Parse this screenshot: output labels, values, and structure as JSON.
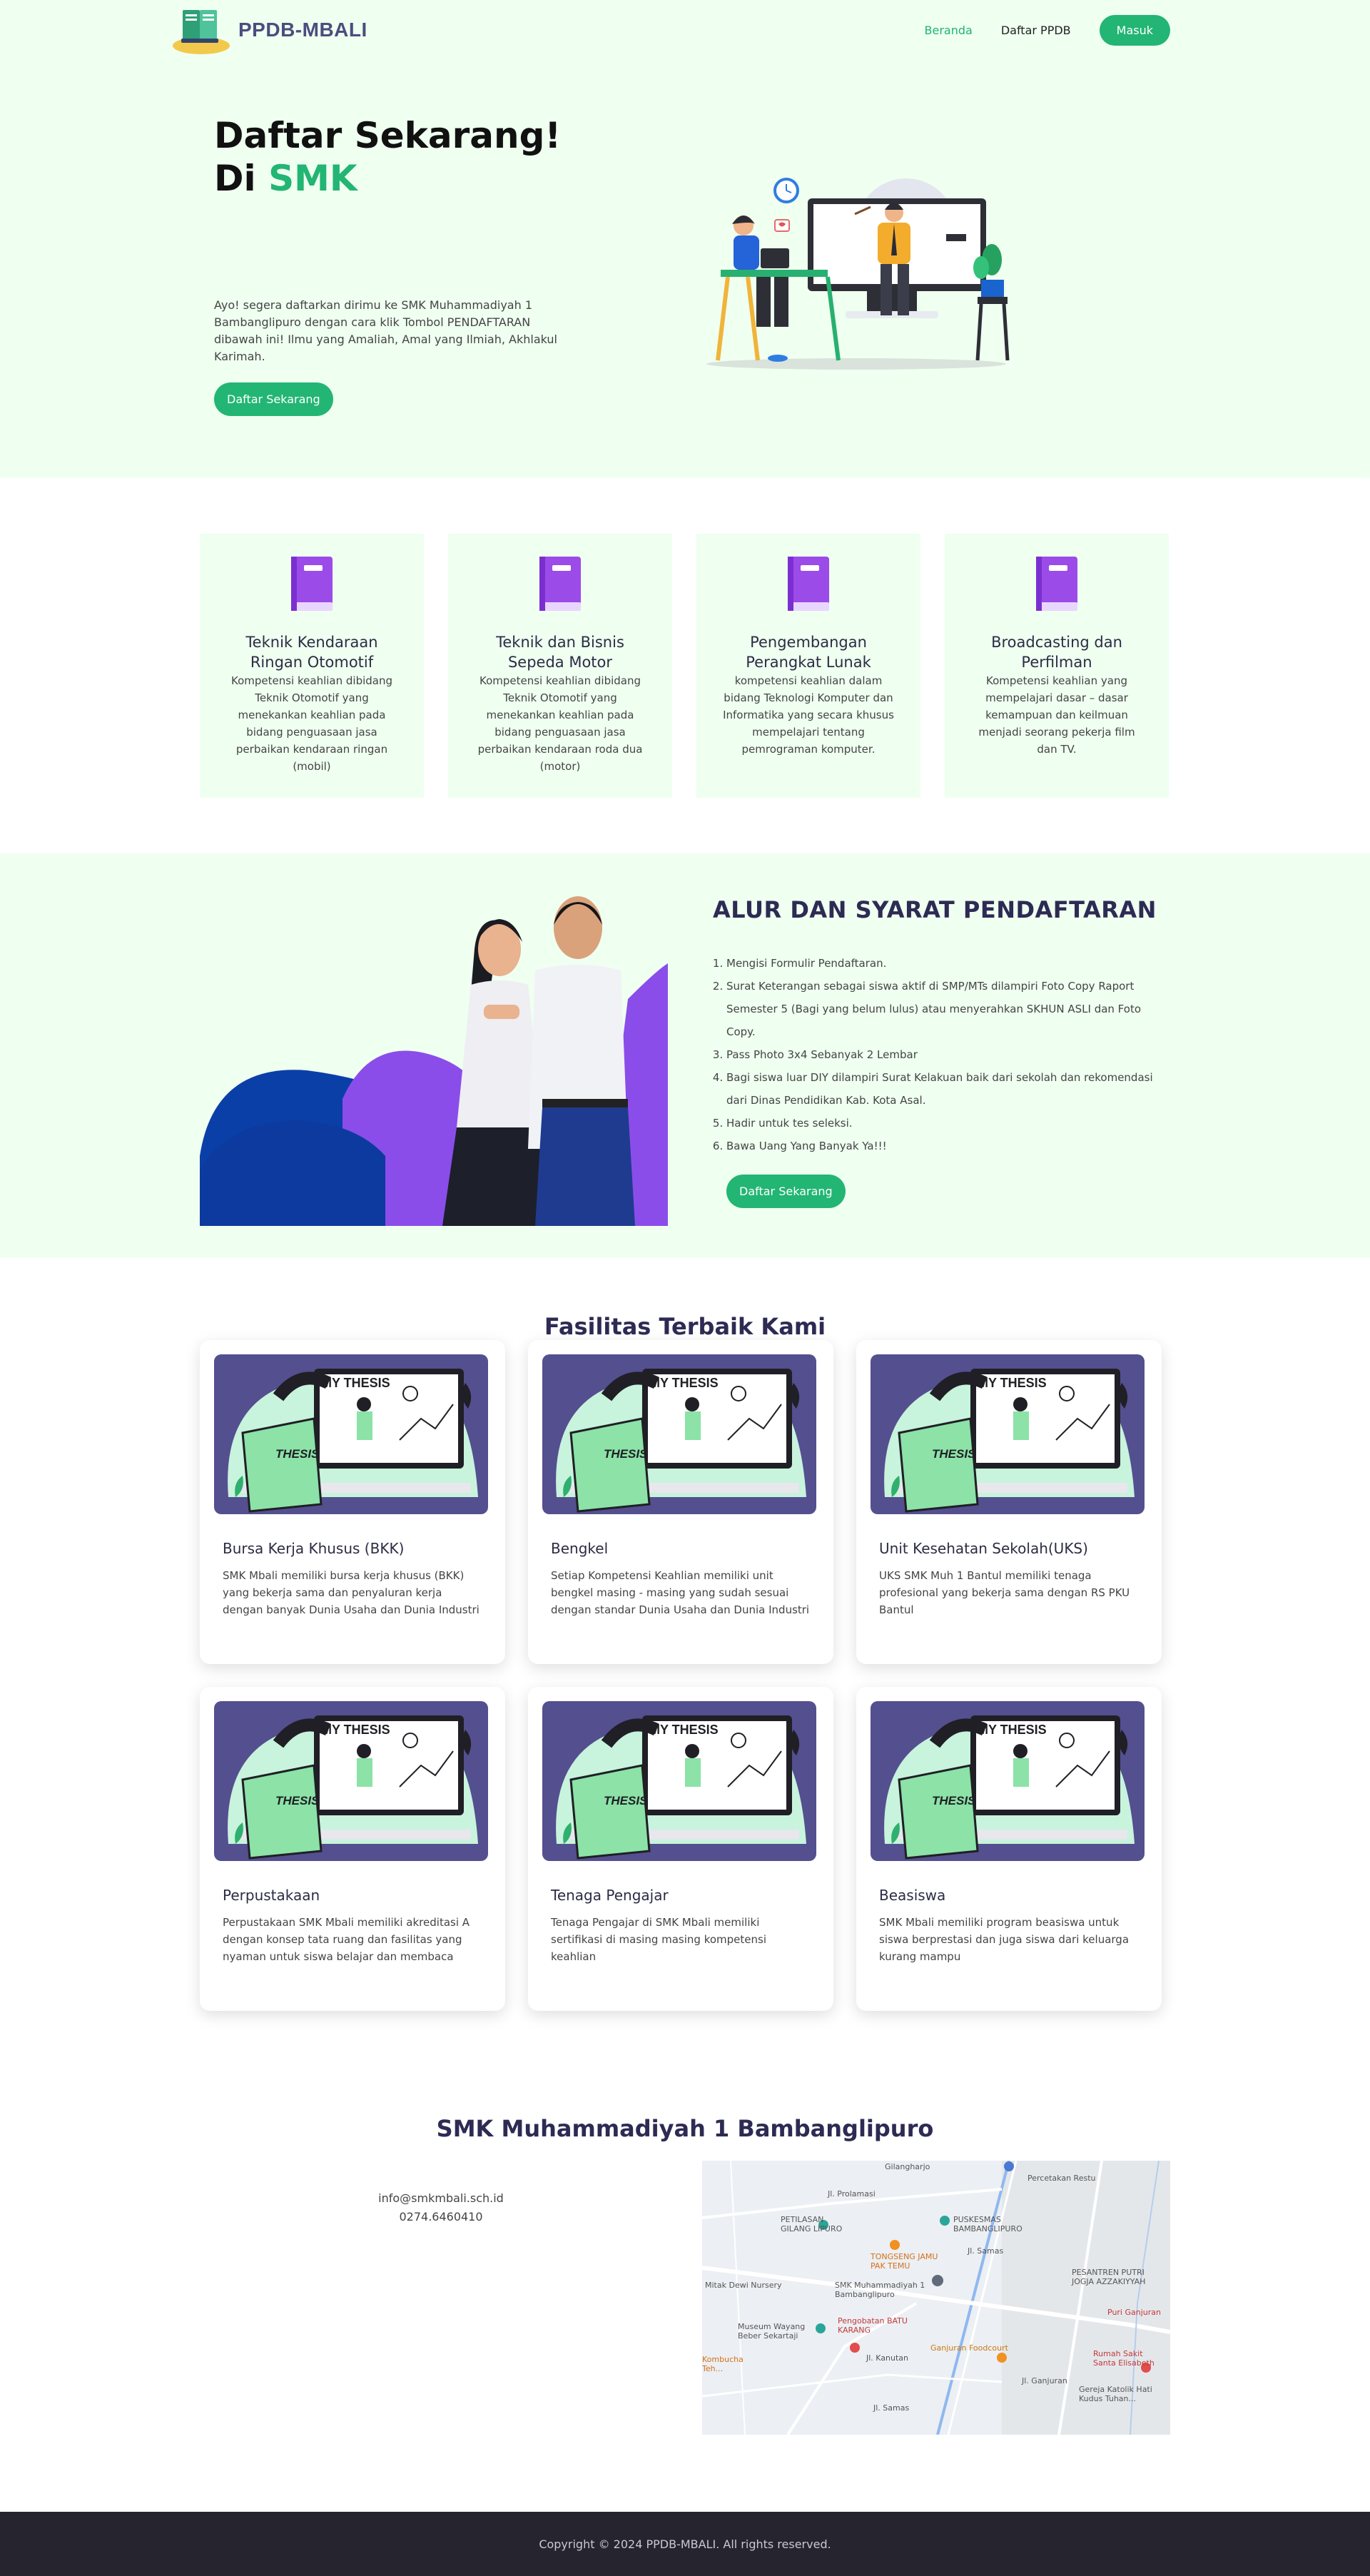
{
  "nav": {
    "brand": "PPDB-MBALI",
    "links": [
      "Beranda",
      "Daftar PPDB"
    ],
    "login": "Masuk"
  },
  "hero": {
    "title_line1": "Daftar Sekarang!",
    "title_line2_prefix": "Di ",
    "title_line2_accent": "SMK",
    "description": "Ayo! segera daftarkan dirimu ke SMK Muhammadiyah 1 Bambanglipuro dengan cara klik Tombol PENDAFTARAN dibawah ini! Ilmu yang Amaliah, Amal yang Ilmiah, Akhlakul Karimah.",
    "cta": "Daftar Sekarang"
  },
  "majors": [
    {
      "title": "Teknik Kendaraan Ringan Otomotif",
      "desc": "Kompetensi keahlian dibidang Teknik Otomotif yang menekankan keahlian pada bidang penguasaan jasa perbaikan kendaraan ringan (mobil)"
    },
    {
      "title": "Teknik dan Bisnis Sepeda Motor",
      "desc": "Kompetensi keahlian dibidang Teknik Otomotif yang menekankan keahlian pada bidang penguasaan jasa perbaikan kendaraan roda dua (motor)"
    },
    {
      "title": "Pengembangan Perangkat Lunak",
      "desc": "kompetensi keahlian dalam bidang Teknologi Komputer dan Informatika yang secara khusus mempelajari tentang pemrograman komputer."
    },
    {
      "title": "Broadcasting dan Perfilman",
      "desc": "Kompetensi keahlian yang mempelajari dasar – dasar kemampuan dan keilmuan menjadi seorang pekerja film dan TV."
    }
  ],
  "alur": {
    "title": "ALUR DAN SYARAT PENDAFTARAN",
    "steps": [
      "Mengisi Formulir Pendaftaran.",
      "Surat Keterangan sebagai siswa aktif di SMP/MTs dilampiri Foto Copy Raport Semester 5 (Bagi yang belum lulus) atau menyerahkan SKHUN ASLI dan Foto Copy.",
      "Pass Photo 3x4 Sebanyak 2 Lembar",
      "Bagi siswa luar DIY dilampiri Surat Kelakuan baik dari sekolah dan rekomendasi dari Dinas Pendidikan Kab. Kota Asal.",
      "Hadir untuk tes seleksi.",
      "Bawa Uang Yang Banyak Ya!!!"
    ],
    "cta": "Daftar Sekarang"
  },
  "fasilitas": {
    "title": "Fasilitas Terbaik Kami",
    "image_text": "MY THESIS",
    "image_book": "THESIS",
    "items": [
      {
        "title": "Bursa Kerja Khusus (BKK)",
        "desc": "SMK Mbali memiliki bursa kerja khusus (BKK) yang bekerja sama dan penyaluran kerja dengan banyak Dunia Usaha dan Dunia Industri"
      },
      {
        "title": "Bengkel",
        "desc": "Setiap Kompetensi Keahlian memiliki unit bengkel masing - masing yang sudah sesuai dengan standar Dunia Usaha dan Dunia Industri"
      },
      {
        "title": "Unit Kesehatan Sekolah(UKS)",
        "desc": "UKS SMK Muh 1 Bantul memiliki tenaga profesional yang bekerja sama dengan RS PKU Bantul"
      },
      {
        "title": "Perpustakaan",
        "desc": "Perpustakaan SMK Mbali memiliki akreditasi A dengan konsep tata ruang dan fasilitas yang nyaman untuk siswa belajar dan membaca"
      },
      {
        "title": "Tenaga Pengajar",
        "desc": "Tenaga Pengajar di SMK Mbali memiliki sertifikasi di masing masing kompetensi keahlian"
      },
      {
        "title": "Beasiswa",
        "desc": "SMK Mbali memiliki program beasiswa untuk siswa berprestasi dan juga siswa dari keluarga kurang mampu"
      }
    ]
  },
  "kontak": {
    "title": "SMK Muhammadiyah 1 Bambanglipuro",
    "email": "info@smkmbali.sch.id",
    "phone": "0274.6460410",
    "map_labels": [
      "Gilangharjo",
      "Percetakan Restu",
      "Jl. Prolamasi",
      "PETILASAN GILANG LIPURO",
      "PUSKESMAS BAMBANGLIPURO",
      "TONGSENG JAMU PAK TEMU",
      "Jl. Samas",
      "PESANTREN PUTRI JOGJA AZZAKIYYAH",
      "Mitak Dewi Nursery",
      "SMK Muhammadiyah 1 Bambanglipuro",
      "Puri Ganjuran",
      "Museum Wayang Beber Sekartaji",
      "Pengobatan BATU KARANG",
      "Jl. Kanutan",
      "Ganjuran Foodcourt",
      "Rumah Sakit Santa Elisabeth",
      "Kombucha Teh...",
      "Gereja Katolik Hati Kudus Tuhan...",
      "Jl. Ganjuran",
      "Jl. Samas"
    ]
  },
  "footer": {
    "copyright": "Copyright © 2024 PPDB-MBALI. All rights reserved."
  },
  "colors": {
    "accent": "#22b573",
    "mint_bg": "#effff0",
    "heading": "#2d2b54",
    "footer_bg": "#26242e",
    "book_purple": "#9b4be8",
    "illustration_bg": "#544f8f"
  }
}
